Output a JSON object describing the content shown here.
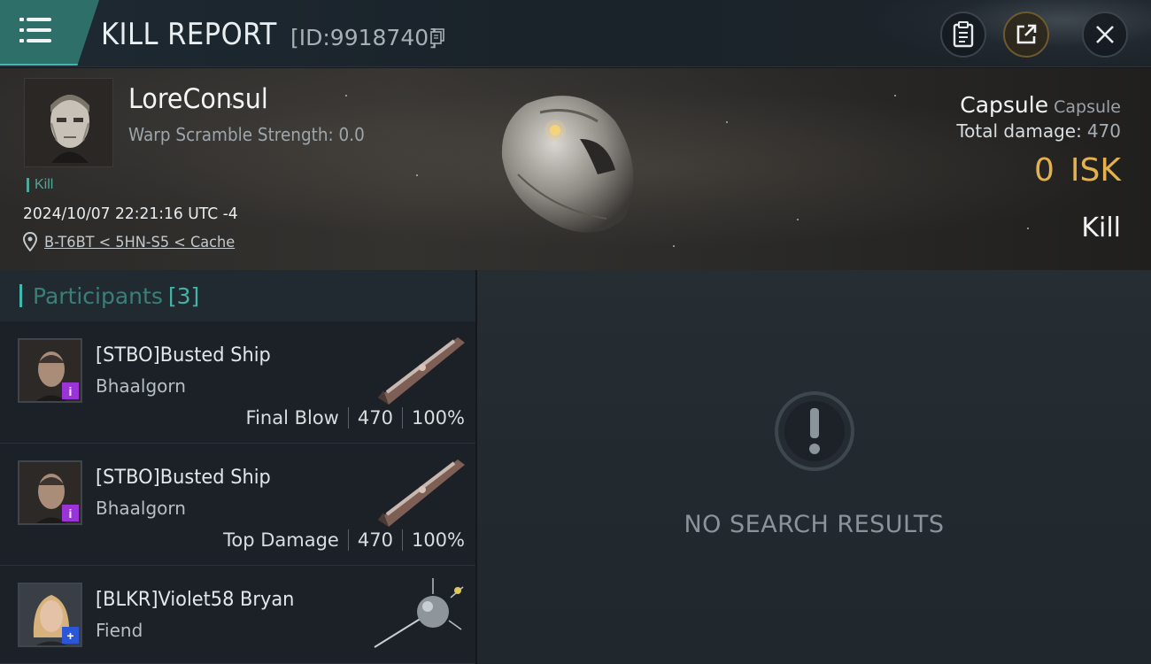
{
  "header": {
    "title": "KILL REPORT",
    "report_id": "[ID:9918740]"
  },
  "victim": {
    "name": "LoreConsul",
    "warp_scramble": "Warp Scramble Strength: 0.0",
    "tag": "Kill",
    "timestamp": "2024/10/07 22:21:16 UTC -4",
    "location": "B-T6BT < 5HN-S5 < Cache",
    "ship_name": "Capsule",
    "ship_class": "Capsule",
    "total_damage_label": "Total damage:",
    "total_damage_value": "470",
    "isk_value": "0",
    "isk_unit": "ISK",
    "result": "Kill"
  },
  "participants": {
    "label": "Participants",
    "count": "[3]",
    "rows": [
      {
        "name": "[STBO]Busted Ship",
        "ship": "Bhaalgorn",
        "role": "Final Blow",
        "damage": "470",
        "percent": "100%"
      },
      {
        "name": "[STBO]Busted Ship",
        "ship": "Bhaalgorn",
        "role": "Top Damage",
        "damage": "470",
        "percent": "100%"
      },
      {
        "name": "[BLKR]Violet58 Bryan",
        "ship": "Fiend"
      }
    ]
  },
  "results": {
    "empty_text": "NO SEARCH RESULTS"
  },
  "colors": {
    "accent": "#3fb9ad",
    "isk": "#e3b24e",
    "badge_purple": "#9b34d8",
    "badge_blue": "#2b56d6"
  },
  "icons": {
    "menu": "menu-icon",
    "copy": "copy-icon",
    "clipboard": "clipboard-icon",
    "share": "share-icon",
    "close": "close-icon",
    "location": "location-pin-icon",
    "empty": "exclamation-icon"
  }
}
